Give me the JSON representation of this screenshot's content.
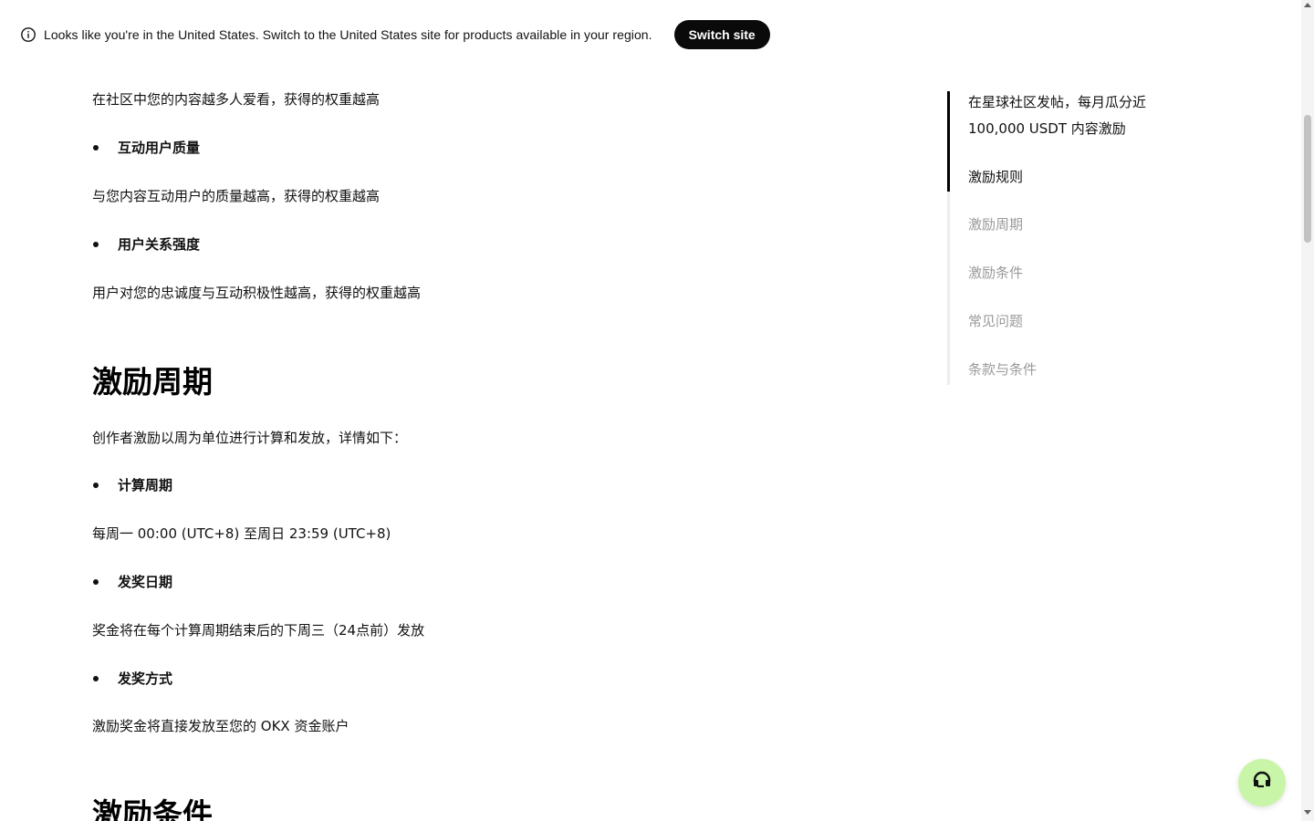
{
  "banner": {
    "icon": "info-icon",
    "text": "Looks like you're in the United States. Switch to the United States site for products available in your region.",
    "button_label": "Switch site"
  },
  "content": {
    "p_weight_popular": "在社区中您的内容越多人爱看，获得的权重越高",
    "bullet_user_quality": "互动用户质量",
    "p_user_quality": "与您内容互动用户的质量越高，获得的权重越高",
    "bullet_relationship": "用户关系强度",
    "p_relationship": "用户对您的忠诚度与互动积极性越高，获得的权重越高",
    "h_cycle": "激励周期",
    "p_cycle_intro": "创作者激励以周为单位进行计算和发放，详情如下：",
    "bullet_calc_period": "计算周期",
    "p_calc_period": "每周一 00:00 (UTC+8) 至周日 23:59 (UTC+8)",
    "bullet_award_date": "发奖日期",
    "p_award_date": "奖金将在每个计算周期结束后的下周三（24点前）发放",
    "bullet_award_method": "发奖方式",
    "p_award_method": "激励奖金将直接发放至您的 OKX 资金账户",
    "h_conditions": "激励条件"
  },
  "toc": {
    "items": [
      {
        "label": "在星球社区发帖，每月瓜分近",
        "state": "active"
      },
      {
        "label": "100,000 USDT 内容激励",
        "state": "active"
      },
      {
        "label": "激励规则",
        "state": "active"
      },
      {
        "label": "激励周期",
        "state": "inactive"
      },
      {
        "label": "激励条件",
        "state": "inactive"
      },
      {
        "label": "常见问题",
        "state": "inactive"
      },
      {
        "label": "条款与条件",
        "state": "inactive"
      }
    ]
  },
  "support": {
    "icon": "headset-icon"
  },
  "colors": {
    "accent_black": "#000000",
    "muted_text": "#9a9a9a",
    "support_green": "#c8f5a8"
  }
}
